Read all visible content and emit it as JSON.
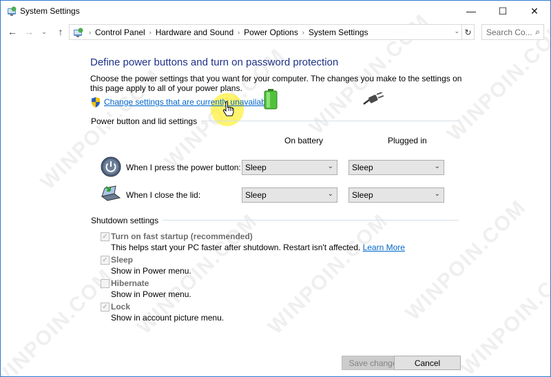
{
  "window": {
    "title": "System Settings",
    "buttons": {
      "minimize": "—",
      "maximize": "☐",
      "close": "✕"
    }
  },
  "nav": {
    "back_glyph": "←",
    "forward_glyph": "→",
    "recent_glyph": "⌄",
    "up_glyph": "↑",
    "breadcrumbs": [
      "Control Panel",
      "Hardware and Sound",
      "Power Options",
      "System Settings"
    ],
    "breadcrumb_separator": "›",
    "dropdown_glyph": "⌄",
    "refresh_glyph": "↻",
    "search_placeholder": "Search Co...",
    "search_glyph": "⌕"
  },
  "content": {
    "heading": "Define power buttons and turn on password protection",
    "description": "Choose the power settings that you want for your computer. The changes you make to the settings on this page apply to all of your power plans.",
    "change_link": "Change settings that are currently unavailable",
    "power_section": {
      "title": "Power button and lid settings",
      "columns": {
        "battery": "On battery",
        "plugged": "Plugged in"
      },
      "rows": [
        {
          "label": "When I press the power button:",
          "battery": "Sleep",
          "plugged": "Sleep"
        },
        {
          "label": "When I close the lid:",
          "battery": "Sleep",
          "plugged": "Sleep"
        }
      ],
      "caret_glyph": "⌄"
    },
    "shutdown_section": {
      "title": "Shutdown settings",
      "check_glyph": "✓",
      "items": [
        {
          "label": "Turn on fast startup (recommended)",
          "description": "This helps start your PC faster after shutdown. Restart isn't affected.",
          "link": "Learn More",
          "checked": true
        },
        {
          "label": "Sleep",
          "description": "Show in Power menu.",
          "checked": true
        },
        {
          "label": "Hibernate",
          "description": "Show in Power menu.",
          "checked": false
        },
        {
          "label": "Lock",
          "description": "Show in account picture menu.",
          "checked": true
        }
      ]
    }
  },
  "footer": {
    "save_label": "Save changes",
    "cancel_label": "Cancel"
  },
  "watermark": "WINPOIN.COM",
  "colors": {
    "heading": "#1e3287",
    "link": "#0066cc",
    "window_border": "#2b79d0",
    "highlight": "#fff03c"
  }
}
